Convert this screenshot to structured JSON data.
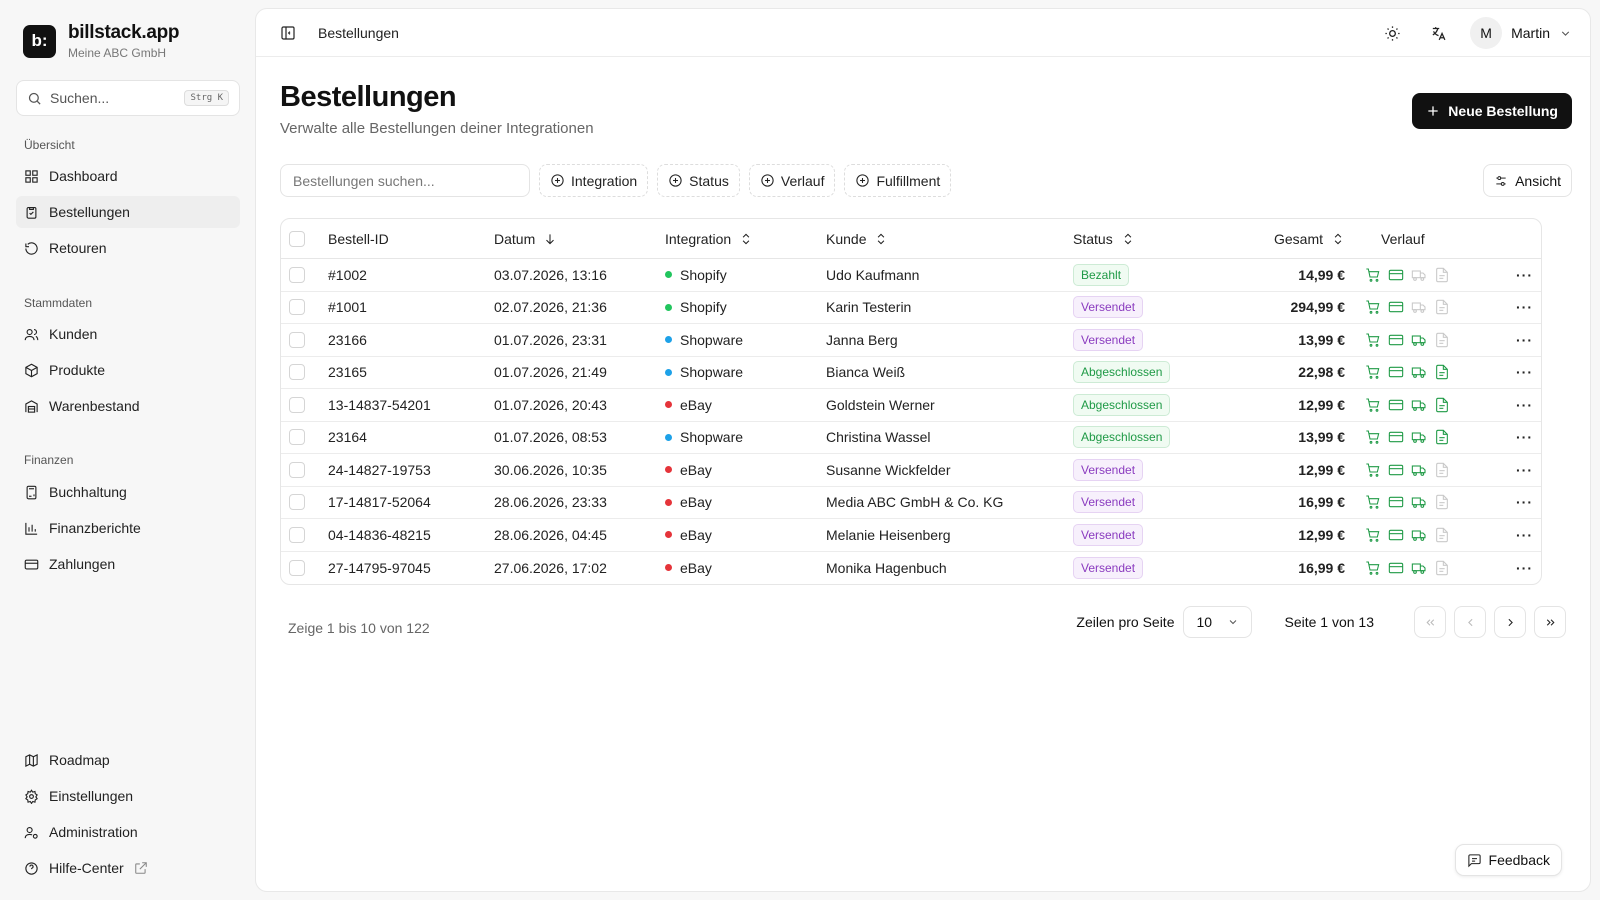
{
  "brand": {
    "logo_text": "b:",
    "name": "billstack.app",
    "company": "Meine ABC GmbH"
  },
  "search": {
    "placeholder": "Suchen...",
    "shortcut": "Strg K"
  },
  "sidebar": {
    "sections": [
      {
        "title": "Übersicht",
        "items": [
          {
            "label": "Dashboard",
            "icon": "grid-icon"
          },
          {
            "label": "Bestellungen",
            "icon": "clipboard-icon",
            "active": true
          },
          {
            "label": "Retouren",
            "icon": "rotate-ccw-icon"
          }
        ]
      },
      {
        "title": "Stammdaten",
        "items": [
          {
            "label": "Kunden",
            "icon": "users-icon"
          },
          {
            "label": "Produkte",
            "icon": "package-icon"
          },
          {
            "label": "Warenbestand",
            "icon": "warehouse-icon"
          }
        ]
      },
      {
        "title": "Finanzen",
        "items": [
          {
            "label": "Buchhaltung",
            "icon": "calculator-icon"
          },
          {
            "label": "Finanzberichte",
            "icon": "bar-chart-icon"
          },
          {
            "label": "Zahlungen",
            "icon": "credit-card-icon"
          }
        ]
      }
    ],
    "bottom": [
      {
        "label": "Roadmap",
        "icon": "map-icon"
      },
      {
        "label": "Einstellungen",
        "icon": "gear-icon"
      },
      {
        "label": "Administration",
        "icon": "user-cog-icon"
      },
      {
        "label": "Hilfe-Center",
        "icon": "help-circle-icon"
      }
    ]
  },
  "topbar": {
    "breadcrumb": "Bestellungen",
    "user_initial": "M",
    "user_name": "Martin"
  },
  "page": {
    "title": "Bestellungen",
    "subtitle": "Verwalte alle Bestellungen deiner Integrationen",
    "new_button": "Neue Bestellung",
    "filter_placeholder": "Bestellungen suchen...",
    "filters": [
      "Integration",
      "Status",
      "Verlauf",
      "Fulfillment"
    ],
    "view_button": "Ansicht"
  },
  "table": {
    "headers": {
      "id": "Bestell-ID",
      "date": "Datum",
      "integration": "Integration",
      "customer": "Kunde",
      "status": "Status",
      "total": "Gesamt",
      "history": "Verlauf"
    },
    "rows": [
      {
        "id": "#1002",
        "date": "03.07.2026, 13:16",
        "integration": "Shopify",
        "customer": "Udo Kaufmann",
        "status": "Bezahlt",
        "total": "14,99 €",
        "history": [
          1,
          1,
          0,
          0
        ]
      },
      {
        "id": "#1001",
        "date": "02.07.2026, 21:36",
        "integration": "Shopify",
        "customer": "Karin Testerin",
        "status": "Versendet",
        "total": "294,99 €",
        "history": [
          1,
          1,
          0,
          0
        ]
      },
      {
        "id": "23166",
        "date": "01.07.2026, 23:31",
        "integration": "Shopware",
        "customer": "Janna Berg",
        "status": "Versendet",
        "total": "13,99 €",
        "history": [
          1,
          1,
          1,
          0
        ]
      },
      {
        "id": "23165",
        "date": "01.07.2026, 21:49",
        "integration": "Shopware",
        "customer": "Bianca Weiß",
        "status": "Abgeschlossen",
        "total": "22,98 €",
        "history": [
          1,
          1,
          1,
          1
        ]
      },
      {
        "id": "13-14837-54201",
        "date": "01.07.2026, 20:43",
        "integration": "eBay",
        "customer": "Goldstein Werner",
        "status": "Abgeschlossen",
        "total": "12,99 €",
        "history": [
          1,
          1,
          1,
          1
        ]
      },
      {
        "id": "23164",
        "date": "01.07.2026, 08:53",
        "integration": "Shopware",
        "customer": "Christina Wassel",
        "status": "Abgeschlossen",
        "total": "13,99 €",
        "history": [
          1,
          1,
          1,
          1
        ]
      },
      {
        "id": "24-14827-19753",
        "date": "30.06.2026, 10:35",
        "integration": "eBay",
        "customer": "Susanne Wickfelder",
        "status": "Versendet",
        "total": "12,99 €",
        "history": [
          1,
          1,
          1,
          0
        ]
      },
      {
        "id": "17-14817-52064",
        "date": "28.06.2026, 23:33",
        "integration": "eBay",
        "customer": "Media ABC GmbH & Co. KG",
        "status": "Versendet",
        "total": "16,99 €",
        "history": [
          1,
          1,
          1,
          0
        ]
      },
      {
        "id": "04-14836-48215",
        "date": "28.06.2026, 04:45",
        "integration": "eBay",
        "customer": "Melanie Heisenberg",
        "status": "Versendet",
        "total": "12,99 €",
        "history": [
          1,
          1,
          1,
          0
        ]
      },
      {
        "id": "27-14795-97045",
        "date": "27.06.2026, 17:02",
        "integration": "eBay",
        "customer": "Monika Hagenbuch",
        "status": "Versendet",
        "total": "16,99 €",
        "history": [
          1,
          1,
          1,
          0
        ]
      }
    ]
  },
  "integration_colors": {
    "Shopify": "#22c55e",
    "Shopware": "#1da1e8",
    "eBay": "#e5343a"
  },
  "pagination": {
    "info": "Zeige 1 bis 10 von 122",
    "rows_label": "Zeilen pro Seite",
    "rows_value": "10",
    "page_label": "Seite 1 von 13"
  },
  "feedback": "Feedback"
}
